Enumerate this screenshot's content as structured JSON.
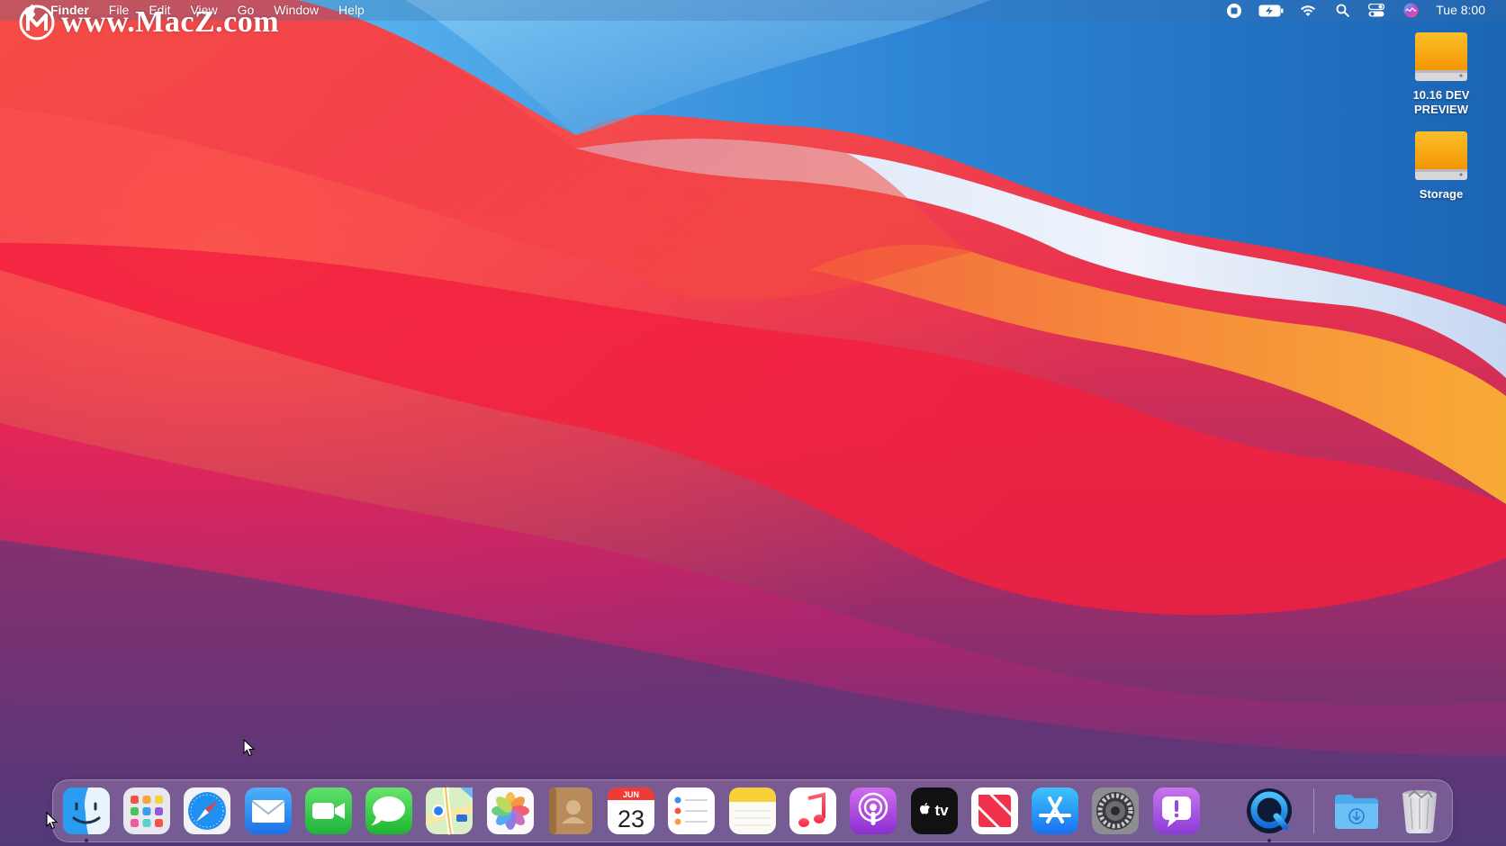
{
  "menubar": {
    "apple_icon": "apple-logo-icon",
    "app_name": "Finder",
    "menus": [
      "File",
      "Edit",
      "View",
      "Go",
      "Window",
      "Help"
    ],
    "status_icons": [
      "screen-record-icon",
      "battery-charging-icon",
      "wifi-icon",
      "spotlight-search-icon",
      "control-center-icon",
      "siri-icon"
    ],
    "clock": "Tue 8:00"
  },
  "watermark": {
    "text": "www.MacZ.com"
  },
  "desktop_icons": [
    {
      "label": "10.16 DEV PREVIEW",
      "icon": "external-drive-icon"
    },
    {
      "label": "Storage",
      "icon": "external-drive-icon"
    }
  ],
  "dock": {
    "apps": [
      {
        "name": "Finder",
        "icon": "finder-icon",
        "running": true
      },
      {
        "name": "Launchpad",
        "icon": "launchpad-icon",
        "running": false
      },
      {
        "name": "Safari",
        "icon": "safari-icon",
        "running": false
      },
      {
        "name": "Mail",
        "icon": "mail-icon",
        "running": false
      },
      {
        "name": "FaceTime",
        "icon": "facetime-icon",
        "running": false
      },
      {
        "name": "Messages",
        "icon": "messages-icon",
        "running": false
      },
      {
        "name": "Maps",
        "icon": "maps-icon",
        "running": false
      },
      {
        "name": "Photos",
        "icon": "photos-icon",
        "running": false
      },
      {
        "name": "Contacts",
        "icon": "contacts-icon",
        "running": false
      },
      {
        "name": "Calendar",
        "icon": "calendar-icon",
        "running": false
      },
      {
        "name": "Reminders",
        "icon": "reminders-icon",
        "running": false
      },
      {
        "name": "Notes",
        "icon": "notes-icon",
        "running": false
      },
      {
        "name": "Music",
        "icon": "music-icon",
        "running": false
      },
      {
        "name": "Podcasts",
        "icon": "podcasts-icon",
        "running": false
      },
      {
        "name": "TV",
        "icon": "apple-tv-icon",
        "running": false
      },
      {
        "name": "News",
        "icon": "news-icon",
        "running": false
      },
      {
        "name": "App Store",
        "icon": "app-store-icon",
        "running": false
      },
      {
        "name": "System Preferences",
        "icon": "system-preferences-icon",
        "running": false
      },
      {
        "name": "Feedback Assistant",
        "icon": "feedback-assistant-icon",
        "running": false
      },
      {
        "name": "QuickTime Player",
        "icon": "quicktime-icon",
        "running": true
      }
    ],
    "calendar": {
      "month": "JUN",
      "day": "23"
    },
    "tv_label": "tv",
    "stacks": [
      {
        "name": "Downloads",
        "icon": "downloads-folder-icon"
      },
      {
        "name": "Trash",
        "icon": "trash-icon"
      }
    ]
  },
  "colors": {
    "wallpaper_blue": "#1f6fc0",
    "wallpaper_red": "#f0163d",
    "wallpaper_orange": "#f7933a",
    "wallpaper_purple": "#5a3a7a",
    "drive_orange": "#f6a00f"
  }
}
